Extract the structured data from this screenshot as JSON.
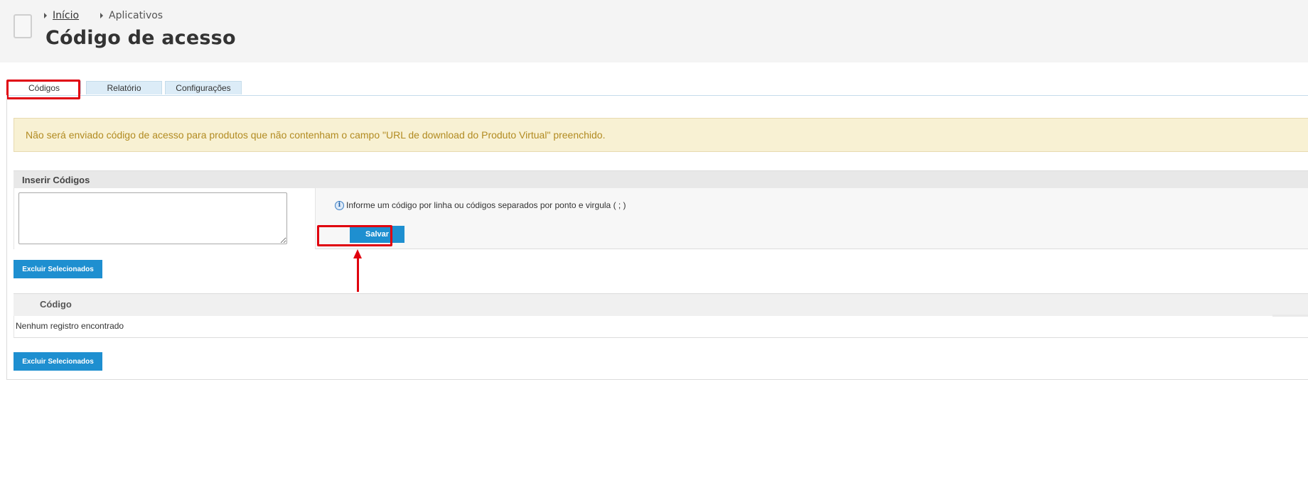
{
  "breadcrumb": {
    "home_label": "Início",
    "current_label": "Aplicativos"
  },
  "page_title": "Código de acesso",
  "tabs": [
    {
      "label": "Códigos",
      "active": true
    },
    {
      "label": "Relatório",
      "active": false
    },
    {
      "label": "Configurações",
      "active": false
    }
  ],
  "alert_text": "Não será enviado código de acesso para produtos que não contenham o campo \"URL de download do Produto Virtual\" preenchido.",
  "insert_section": {
    "title": "Inserir Códigos",
    "textarea_value": "",
    "info_icon": "info-icon",
    "info_text": "Informe um código por linha ou códigos separados por ponto e virgula ( ; )",
    "save_label": "Salvar"
  },
  "delete_selected_label": "Excluir Selecionados",
  "table": {
    "column_header": "Código",
    "empty_message": "Nenhum registro encontrado"
  },
  "colors": {
    "accent": "#1e8fd0",
    "highlight": "#e0000e",
    "alert_bg": "#f8f1d3",
    "alert_text": "#b28b21"
  }
}
